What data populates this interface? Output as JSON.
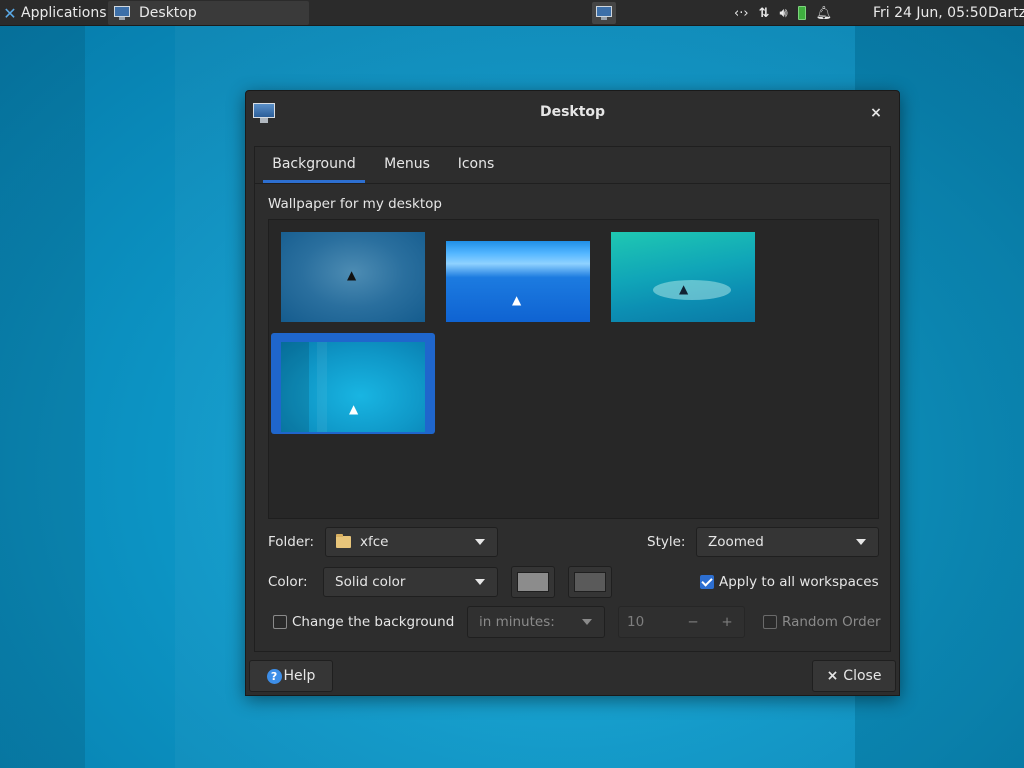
{
  "panel": {
    "applications_label": "Applications",
    "menu_sep": "≡",
    "task_label": "Desktop",
    "tray_icons": [
      "network-arrows-icon",
      "transfer-icon",
      "volume-icon",
      "battery-icon",
      "bell-icon"
    ],
    "clock": "Fri 24 Jun, 05:50",
    "user": "Dartz"
  },
  "dialog": {
    "title": "Desktop",
    "close_glyph": "×",
    "tabs": [
      {
        "label": "Background",
        "active": true
      },
      {
        "label": "Menus",
        "active": false
      },
      {
        "label": "Icons",
        "active": false
      }
    ],
    "wallpaper_label": "Wallpaper for my desktop",
    "wallpapers": [
      {
        "name": "wallpaper-1",
        "selected": false
      },
      {
        "name": "wallpaper-2",
        "selected": false
      },
      {
        "name": "wallpaper-3",
        "selected": false
      },
      {
        "name": "wallpaper-4",
        "selected": true
      }
    ],
    "folder_label": "Folder:",
    "folder_value": "xfce",
    "style_label": "Style:",
    "style_value": "Zoomed",
    "color_label": "Color:",
    "color_value": "Solid color",
    "primary_color": "#8c8c8c",
    "secondary_color": "#5a5a5a",
    "apply_all_label": "Apply to all workspaces",
    "apply_all_checked": true,
    "change_bg_label": "Change the background",
    "change_bg_checked": false,
    "interval_unit": "in minutes:",
    "interval_value": "10",
    "minus_glyph": "−",
    "plus_glyph": "+",
    "random_order_label": "Random Order",
    "random_order_checked": false,
    "help_label": "Help",
    "help_glyph": "?",
    "close_label": "Close",
    "close_button_glyph": "×"
  },
  "colors": {
    "accent": "#2d6fd1",
    "dialog_bg": "#2d2d2d",
    "panel_bg": "#2b2b2b"
  }
}
